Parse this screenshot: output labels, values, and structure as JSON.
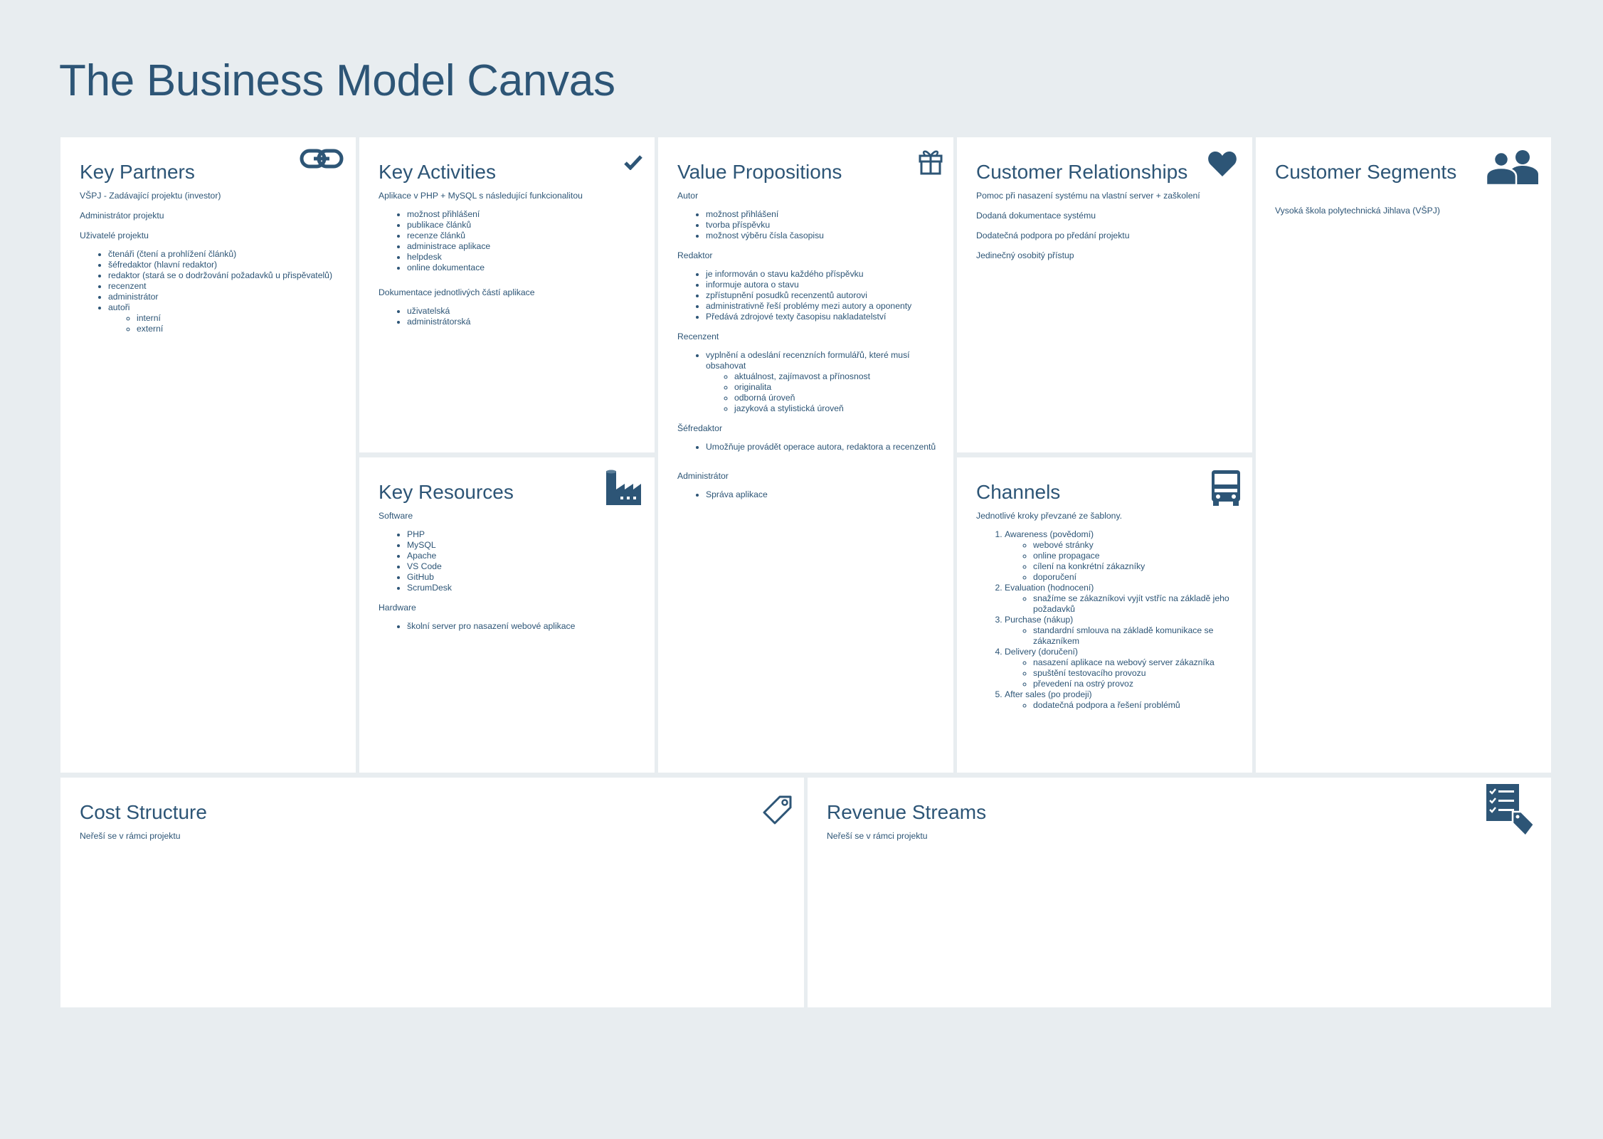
{
  "title": "The Business Model Canvas",
  "colors": {
    "background": "#e8edf0",
    "panel": "#ffffff",
    "accent": "#2d5576"
  },
  "key_partners": {
    "heading": "Key Partners",
    "icon": "link-icon",
    "lines": [
      "VŠPJ - Zadávající projektu (investor)",
      "Administrátor projektu",
      "Uživatelé projektu"
    ],
    "roles": [
      "čtenáři (čtení a prohlížení článků)",
      "šéfredaktor (hlavní redaktor)",
      "redaktor (stará se o dodržování požadavků u přispěvatelů)",
      "recenzent",
      "administrátor",
      "autoři"
    ],
    "author_types": [
      "interní",
      "externí"
    ]
  },
  "key_activities": {
    "heading": "Key Activities",
    "icon": "checkmark-icon",
    "intro": "Aplikace v PHP + MySQL s následující funkcionalitou",
    "features": [
      "možnost přihlášení",
      "publikace článků",
      "recenze článků",
      "administrace aplikace",
      "helpdesk",
      "online dokumentace"
    ],
    "docs_intro": "Dokumentace jednotlivých částí aplikace",
    "docs": [
      "uživatelská",
      "administrátorská"
    ]
  },
  "key_resources": {
    "heading": "Key Resources",
    "icon": "factory-icon",
    "software_label": "Software",
    "software": [
      "PHP",
      "MySQL",
      "Apache",
      "VS Code",
      "GitHub",
      "ScrumDesk"
    ],
    "hardware_label": "Hardware",
    "hardware": [
      "školní server pro nasazení webové aplikace"
    ]
  },
  "value_propositions": {
    "heading": "Value Propositions",
    "icon": "gift-icon",
    "autor_label": "Autor",
    "autor": [
      "možnost přihlášení",
      "tvorba příspěvku",
      "možnost výběru čísla časopisu"
    ],
    "redaktor_label": "Redaktor",
    "redaktor": [
      "je informován o stavu každého příspěvku",
      "informuje autora o stavu",
      "zpřístupnění posudků recenzentů autorovi",
      "administrativně řeší problémy mezi autory a oponenty",
      "Předává zdrojové texty časopisu nakladatelství"
    ],
    "recenzent_label": "Recenzent",
    "recenzent": "vyplnění a odeslání recenzních formulářů, které musí obsahovat",
    "recenzent_sub": [
      "aktuálnost, zajímavost a přínosnost",
      "originalita",
      "odborná úroveň",
      "jazyková a stylistická úroveň"
    ],
    "sefredaktor_label": "Šéfredaktor",
    "sefredaktor": [
      "Umožňuje provádět operace autora, redaktora a recenzentů"
    ],
    "admin_label": "Administrátor",
    "admin": [
      "Správa aplikace"
    ]
  },
  "customer_relationships": {
    "heading": "Customer Relationships",
    "icon": "heart-icon",
    "lines": [
      "Pomoc při nasazení systému na vlastní server + zaškolení",
      "Dodaná dokumentace systému",
      "Dodatečná podpora po předání projektu",
      "Jedinečný osobitý přístup"
    ]
  },
  "channels": {
    "heading": "Channels",
    "icon": "truck-icon",
    "intro": "Jednotlivé kroky převzané ze šablony.",
    "steps": [
      {
        "label": "Awareness (povědomí)",
        "items": [
          "webové stránky",
          "online propagace",
          "cílení na konkrétní zákazníky",
          "doporučení"
        ]
      },
      {
        "label": "Evaluation (hodnocení)",
        "items": [
          "snažíme se zákazníkovi vyjít vstříc na základě jeho požadavků"
        ]
      },
      {
        "label": "Purchase (nákup)",
        "items": [
          "standardní smlouva na základě komunikace se zákazníkem"
        ]
      },
      {
        "label": "Delivery (doručení)",
        "items": [
          "nasazení aplikace na webový server zákazníka",
          "spuštění testovacího provozu",
          "převedení na ostrý provoz"
        ]
      },
      {
        "label": "After sales (po prodeji)",
        "items": [
          "dodatečná podpora a řešení problémů"
        ]
      }
    ]
  },
  "customer_segments": {
    "heading": "Customer Segments",
    "icon": "users-icon",
    "lines": [
      "Vysoká škola polytechnická Jihlava (VŠPJ)"
    ]
  },
  "cost_structure": {
    "heading": "Cost Structure",
    "icon": "price-tag-icon",
    "lines": [
      "Neřeší se v rámci projektu"
    ]
  },
  "revenue_streams": {
    "heading": "Revenue Streams",
    "icon": "checklist-tag-icon",
    "lines": [
      "Neřeší se v rámci projektu"
    ]
  }
}
